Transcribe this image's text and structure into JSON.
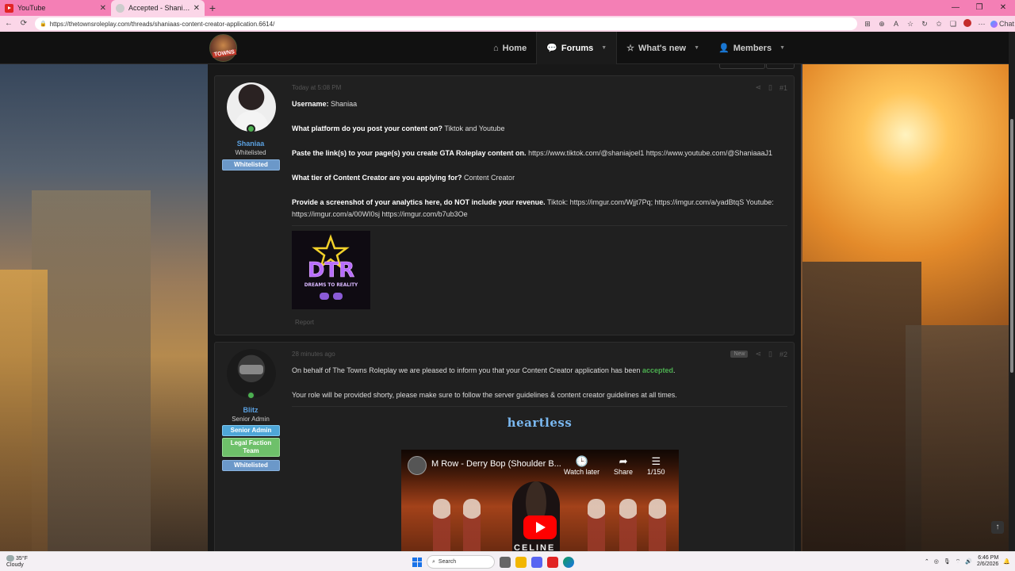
{
  "browser": {
    "tabs": [
      {
        "title": "YouTube",
        "icon": "youtube-icon",
        "active": false
      },
      {
        "title": "Accepted - Shaniaa's Content Creator Application",
        "icon": "site-favicon-icon",
        "active": true
      }
    ],
    "url": "https://thetownsroleplay.com/threads/shaniaas-content-creator-application.6614/",
    "chat_label": "Chat"
  },
  "site": {
    "logo_text": "TOWNS",
    "nav": [
      {
        "label": "Home",
        "icon": "home-icon"
      },
      {
        "label": "Forums",
        "icon": "forums-icon",
        "active": true,
        "dropdown": true
      },
      {
        "label": "What's new",
        "icon": "star-icon",
        "dropdown": true
      },
      {
        "label": "Members",
        "icon": "user-icon",
        "dropdown": true
      }
    ]
  },
  "posts": [
    {
      "author": "Shaniaa",
      "user_title": "Whitelisted",
      "banners": [
        "Whitelisted"
      ],
      "time": "Today at 5:08 PM",
      "number": "#1",
      "fields": [
        {
          "q": "Username:",
          "a": "Shaniaa"
        },
        {
          "q": "What platform do you post your content on?",
          "a": "Tiktok and Youtube"
        },
        {
          "q": "Paste the link(s) to your page(s) you create GTA Roleplay content on.",
          "a": "https://www.tiktok.com/@shaniajoel1 https://www.youtube.com/@ShaniaaaJ1"
        },
        {
          "q": "What tier of Content Creator are you applying for?",
          "a": "Content Creator"
        },
        {
          "q": "Provide a screenshot of your analytics here, do NOT include your revenue.",
          "a": "Tiktok: https://imgur.com/Wjjt7Pq; https://imgur.com/a/yadBtqS Youtube: https://imgur.com/a/00WI0sj https://imgur.com/b7ub3Oe"
        }
      ],
      "image": {
        "line1": "DTR",
        "line2": "DREAMS TO REALITY"
      },
      "report_label": "Report"
    },
    {
      "author": "Blitz",
      "user_title": "Senior Admin",
      "banners": [
        "Senior Admin",
        "Legal Faction Team",
        "Whitelisted"
      ],
      "time": "28 minutes ago",
      "number": "#2",
      "new_badge": "New",
      "line1_pre": "On behalf of The Towns Roleplay we are pleased to inform you that your Content Creator application has been ",
      "line1_status": "accepted",
      "line1_post": ".",
      "line2": "Your role will be provided shorty, please make sure to follow the server guidelines & content creator guidelines at all times.",
      "signature": "heartless",
      "video": {
        "title": "M Row - Derry Bop (Shoulder B...",
        "watch_later": "Watch later",
        "share": "Share",
        "playlist": "1/150",
        "brand": "CELINE"
      }
    }
  ],
  "taskbar": {
    "temp": "35°F",
    "condition": "Cloudy",
    "search_label": "Search",
    "time": "6:46 PM",
    "date": "2/6/2026"
  },
  "colors": {
    "tab_bar": "#f47fb5",
    "link_blue": "#5aa0e0",
    "accepted_green": "#4caf50"
  }
}
